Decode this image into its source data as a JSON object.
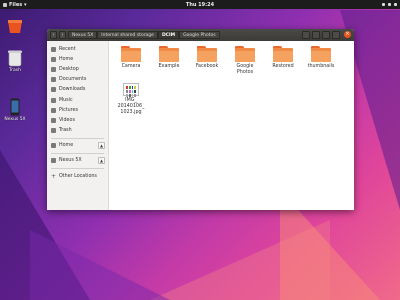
{
  "topbar": {
    "app_menu": "Files ▾",
    "clock": "Thu 19:24"
  },
  "desktop": {
    "icons": [
      {
        "label": ""
      },
      {
        "label": "Trash"
      },
      {
        "label": "Nexus 5X"
      }
    ]
  },
  "window": {
    "nav": {
      "back": "‹",
      "forward": "›"
    },
    "breadcrumbs": [
      "Nexus 5X",
      "Internal shared storage",
      "DCIM",
      "Google Photos"
    ],
    "close_glyph": "×"
  },
  "sidebar": {
    "places": [
      "Recent",
      "Home",
      "Desktop",
      "Documents",
      "Downloads",
      "Music",
      "Pictures",
      "Videos",
      "Trash"
    ],
    "devices": [
      "Home",
      "Nexus 5X"
    ],
    "other": "Other Locations",
    "eject_glyph": "▲",
    "add_glyph": "+"
  },
  "content": {
    "folders": [
      "Camera",
      "Example",
      "Facebook",
      "Google Photos",
      "Restored",
      "thumbnails"
    ],
    "file": {
      "label_line1": "IMG_",
      "label_line2": "20140106_",
      "label_line3": "1023.jpg"
    }
  },
  "colors": {
    "accent": "#e95420",
    "folder": "#f08a45"
  }
}
